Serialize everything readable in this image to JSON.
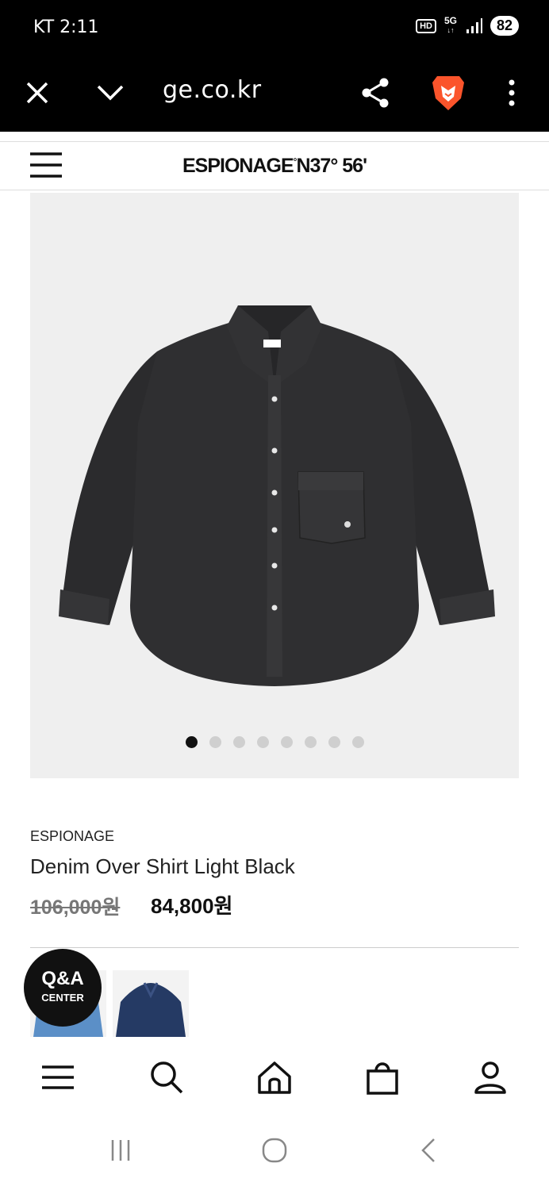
{
  "status_bar": {
    "carrier_time": "KT 2:11",
    "hd": "HD",
    "network": "5G",
    "battery": "82"
  },
  "browser": {
    "url": "ge.co.kr"
  },
  "site": {
    "logo": "ESPIONAGE",
    "logo_mark": "°",
    "logo_coord": "N37° 56'"
  },
  "gallery": {
    "total_images": 8,
    "active_index": 0
  },
  "product": {
    "brand": "ESPIONAGE",
    "name": "Denim Over Shirt Light Black",
    "original_price": "106,000원",
    "sale_price": "84,800원"
  },
  "qa_button": {
    "line1": "Q&A",
    "line2": "CENTER"
  },
  "colors": {
    "status_bg": "#000000",
    "gallery_bg": "#efefef",
    "shirt": "#2f2f31",
    "thumb_blue": "#5b8fc7",
    "thumb_navy": "#253a64"
  }
}
